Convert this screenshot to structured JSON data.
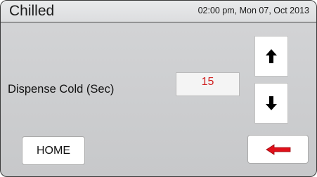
{
  "header": {
    "title": "Chilled",
    "datetime": "02:00 pm, Mon 07, Oct 2013"
  },
  "setting": {
    "label": "Dispense Cold (Sec)",
    "value": "15"
  },
  "buttons": {
    "home_label": "HOME",
    "increment_icon": "up-arrow-icon",
    "decrement_icon": "down-arrow-icon",
    "back_icon": "left-arrow-icon"
  },
  "colors": {
    "value_text": "#d02020",
    "back_arrow": "#e0101a",
    "nav_arrow": "#000000"
  }
}
